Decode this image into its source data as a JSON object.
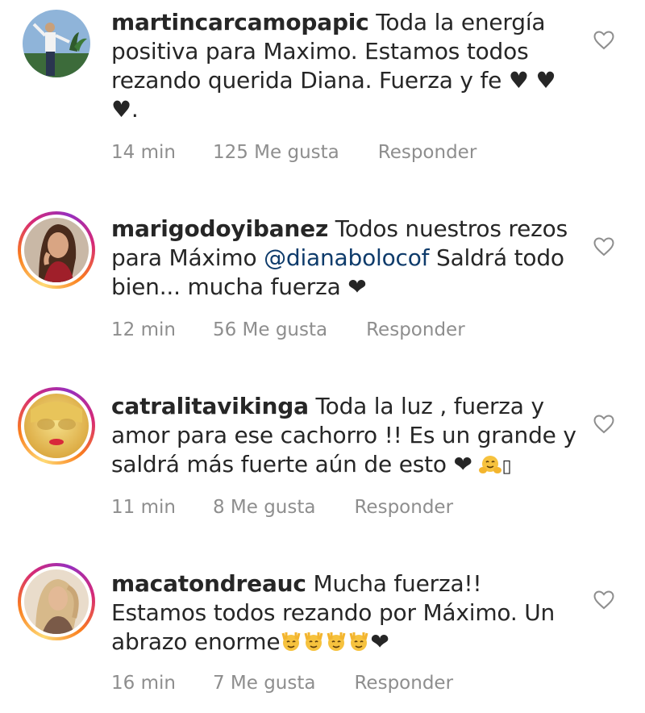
{
  "comments": [
    {
      "username": "martincarcamopapic",
      "text": " Toda la energía positiva para Maximo. Estamos todos rezando querida Diana. Fuerza y fe ♥ ♥ ♥.",
      "time": "14 min",
      "likes": "125 Me gusta",
      "reply": "Responder",
      "has_story": false
    },
    {
      "username": "marigodoyibanez",
      "text_before": " Todos nuestros rezos para Máximo ",
      "mention": "@dianabolocof",
      "text_after": " Saldrá todo bien... mucha fuerza ❤",
      "time": "12 min",
      "likes": "56 Me gusta",
      "reply": "Responder",
      "has_story": true
    },
    {
      "username": "catralitavikinga",
      "text": " Toda la luz , fuerza y amor para ese cachorro !! Es un grande y saldrá más fuerte aún de esto ❤",
      "text_tail": "▯",
      "time": "11 min",
      "likes": "8 Me gusta",
      "reply": "Responder",
      "has_story": true
    },
    {
      "username": "macatondreauc",
      "text": " Mucha fuerza!! Estamos todos rezando por Máximo. Un abrazo enorme",
      "text_tail": "❤",
      "time": "16 min",
      "likes": "7 Me gusta",
      "reply": "Responder",
      "has_story": true
    }
  ],
  "icons": {
    "like": "heart-outline-icon",
    "hugging_emoji": "hugging-face-icon",
    "raised_hands_emoji": "raising-hands-face-icon"
  },
  "colors": {
    "text": "#262626",
    "meta": "#8e8e8e",
    "mention": "#0e3b6b",
    "story_ring": "#d62976"
  }
}
